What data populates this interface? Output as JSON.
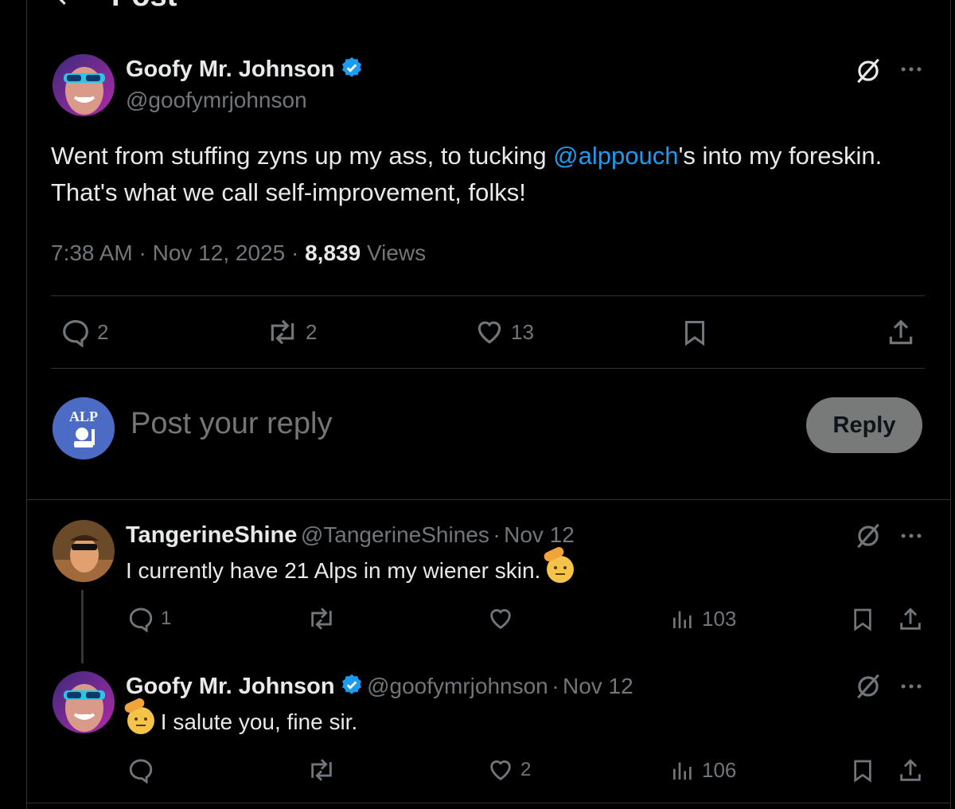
{
  "header": {
    "title": "Post",
    "back_icon": "arrow-left-icon"
  },
  "main_post": {
    "author_name": "Goofy Mr. Johnson",
    "author_handle": "@goofymrjohnson",
    "text_before": "Went from stuffing zyns up my ass, to tucking ",
    "mention": "@alppouch",
    "text_after": "'s into my foreskin. That's what we call self-improvement, folks!",
    "time": "7:38 AM",
    "date": "Nov 12, 2025",
    "views_count": "8,839",
    "views_label": "Views",
    "replies": "2",
    "reposts": "2",
    "likes": "13",
    "colors": {
      "accent": "#1d9bf0",
      "verified": "#1d9bf0"
    }
  },
  "composer": {
    "placeholder": "Post your reply",
    "reply_button": "Reply",
    "avatar_text": "ALP"
  },
  "replies": [
    {
      "author_name": "TangerineShine",
      "author_handle": "@TangerineShines",
      "date": "Nov 12",
      "text": "I currently have 21 Alps in my wiener skin.",
      "emoji": "saluting-face",
      "replies": "1",
      "reposts": "",
      "likes": "",
      "views": "103"
    },
    {
      "author_name": "Goofy Mr. Johnson",
      "author_handle": "@goofymrjohnson",
      "date": "Nov 12",
      "text": "I salute you, fine sir.",
      "emoji": "saluting-face",
      "replies": "",
      "reposts": "",
      "likes": "2",
      "views": "106"
    }
  ],
  "separator": "·"
}
